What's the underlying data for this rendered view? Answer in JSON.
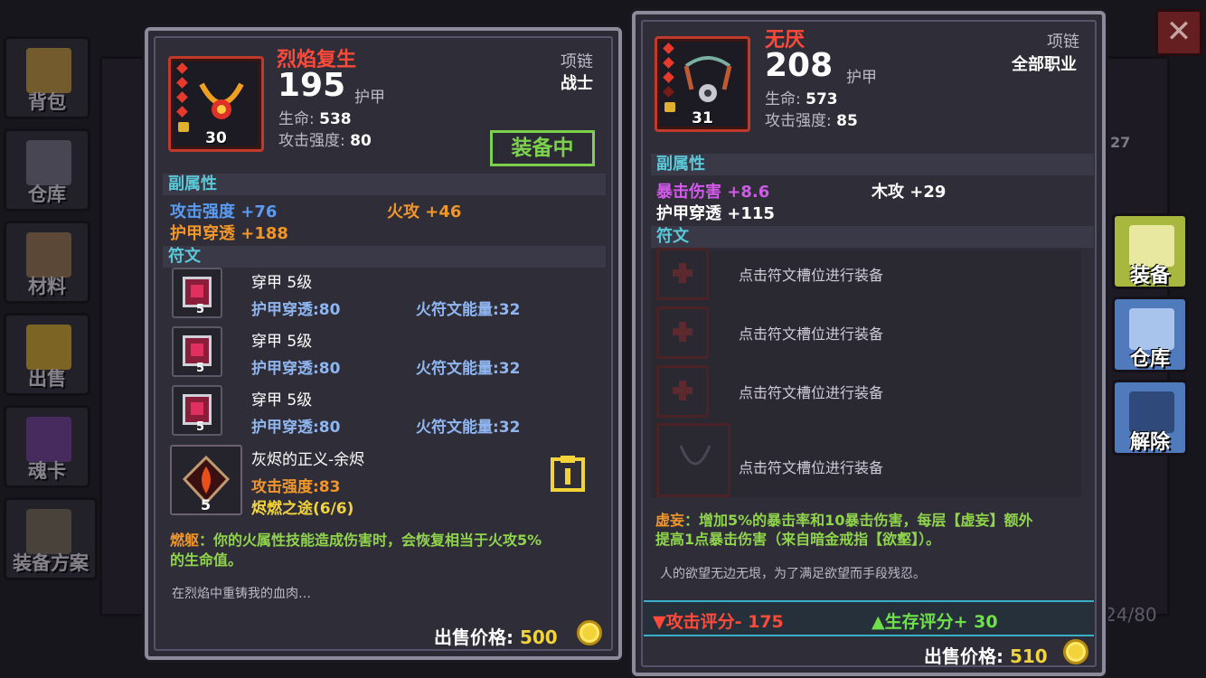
{
  "background_nav": {
    "left_items": [
      {
        "label": "背包",
        "icon": "backpack-icon"
      },
      {
        "label": "仓库",
        "icon": "warehouse-icon"
      },
      {
        "label": "材料",
        "icon": "materials-icon"
      },
      {
        "label": "出售",
        "icon": "sell-icon"
      },
      {
        "label": "魂卡",
        "icon": "soul-card-icon"
      },
      {
        "label": "装备方案",
        "icon": "equipment-plan-icon"
      }
    ],
    "bg_count": "24/80",
    "bg_level": "27"
  },
  "right_nav": [
    {
      "label": "装备",
      "icon": "equip-icon",
      "color": "#b7c94a"
    },
    {
      "label": "仓库",
      "icon": "warehouse-icon",
      "color": "#5a86c4"
    },
    {
      "label": "解除",
      "icon": "unlock-icon",
      "color": "#5a86c4"
    }
  ],
  "close_icon": "close-icon",
  "left_card": {
    "name": "烈焰复生",
    "type": "项链",
    "class": "战士",
    "armor_value": "195",
    "armor_label": "护甲",
    "level": "30",
    "stats": [
      {
        "label": "生命:",
        "value": "538"
      },
      {
        "label": "攻击强度:",
        "value": "80"
      }
    ],
    "equipped_label": "装备中",
    "sub_attr_header": "副属性",
    "sub_attrs": [
      {
        "text": "攻击强度 +76",
        "color": "#5a9bf0"
      },
      {
        "text": "火攻 +46",
        "color": "#f0962a"
      },
      {
        "text": "护甲穿透 +188",
        "color": "#f0962a"
      }
    ],
    "rune_header": "符文",
    "runes": [
      {
        "name": "穿甲 5级",
        "stat1": "护甲穿透:80",
        "stat2": "火符文能量:32",
        "level": "5"
      },
      {
        "name": "穿甲 5级",
        "stat1": "护甲穿透:80",
        "stat2": "火符文能量:32",
        "level": "5"
      },
      {
        "name": "穿甲 5级",
        "stat1": "护甲穿透:80",
        "stat2": "火符文能量:32",
        "level": "5"
      }
    ],
    "special_rune": {
      "name": "灰烬的正义-余烬",
      "stat": "攻击强度:83",
      "set": "烬燃之途(6/6)",
      "level": "5"
    },
    "effect_label": "燃躯",
    "effect_text": "：你的火属性技能造成伤害时，会恢复相当于火攻5%",
    "effect_text2": "的生命值。",
    "flavor": "在烈焰中重铸我的血肉…",
    "price_label": "出售价格:",
    "price": "500"
  },
  "right_card": {
    "name": "无厌",
    "type": "项链",
    "class": "全部职业",
    "armor_value": "208",
    "armor_label": "护甲",
    "level": "31",
    "stats": [
      {
        "label": "生命:",
        "value": "573"
      },
      {
        "label": "攻击强度:",
        "value": "85"
      }
    ],
    "sub_attr_header": "副属性",
    "sub_attrs": [
      {
        "text": "暴击伤害 +8.6",
        "color": "#d15ae8"
      },
      {
        "text": "木攻 +29",
        "color": "#ffffff"
      },
      {
        "text": "护甲穿透 +115",
        "color": "#ffffff"
      }
    ],
    "rune_header": "符文",
    "rune_slot_hint": "点击符文槽位进行装备",
    "rune_slots": [
      "点击符文槽位进行装备",
      "点击符文槽位进行装备",
      "点击符文槽位进行装备",
      "点击符文槽位进行装备"
    ],
    "effect_label": "虚妄",
    "effect_text": "：增加5%的暴击率和10暴击伤害，每层【虚妄】额外",
    "effect_text2": "提高1点暴击伤害（来自暗金戒指【欲壑】）。",
    "flavor": "人的欲望无边无垠，为了满足欲望而手段残忍。",
    "attack_score": "▼攻击评分- 175",
    "survive_score": "▲生存评分+ 30",
    "price_label": "出售价格:",
    "price": "510"
  }
}
